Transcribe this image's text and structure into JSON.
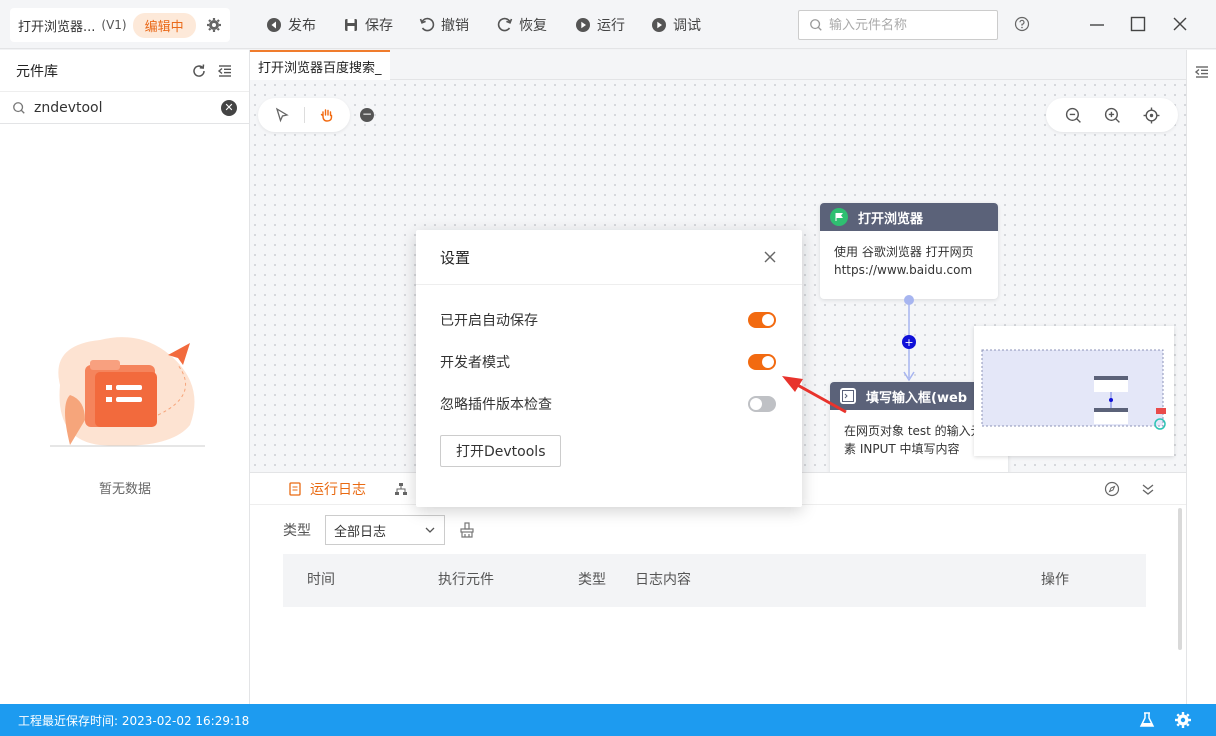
{
  "project": {
    "name": "打开浏览器...",
    "version": "(V1)",
    "status_badge": "编辑中"
  },
  "toolbar": {
    "publish": "发布",
    "save": "保存",
    "undo": "撤销",
    "redo": "恢复",
    "run": "运行",
    "debug": "调试"
  },
  "search": {
    "placeholder": "输入元件名称"
  },
  "library": {
    "title": "元件库",
    "search_value": "zndevtool",
    "empty_text": "暂无数据"
  },
  "tabs": [
    {
      "label": "打开浏览器百度搜索_"
    }
  ],
  "nodes": {
    "open_browser": {
      "title": "打开浏览器",
      "body": "使用 谷歌浏览器 打开网页https://www.baidu.com"
    },
    "fill_input": {
      "title": "填写输入框(web",
      "body": "在网页对象 test 的输入元素 INPUT 中填写内容"
    }
  },
  "settings": {
    "title": "设置",
    "rows": [
      {
        "label": "已开启自动保存",
        "on": true
      },
      {
        "label": "开发者模式",
        "on": true
      },
      {
        "label": "忽略插件版本检查",
        "on": false
      }
    ],
    "devtools_button": "打开Devtools"
  },
  "log": {
    "tab_label": "运行日志",
    "filter_label": "类型",
    "filter_value": "全部日志",
    "columns": [
      "时间",
      "执行元件",
      "类型",
      "日志内容",
      "操作"
    ]
  },
  "status_bar": {
    "text": "工程最近保存时间: 2023-02-02 16:29:18"
  },
  "colors": {
    "accent": "#f26a10",
    "status_bar": "#1d9bf0",
    "node_header": "#5b6279"
  }
}
